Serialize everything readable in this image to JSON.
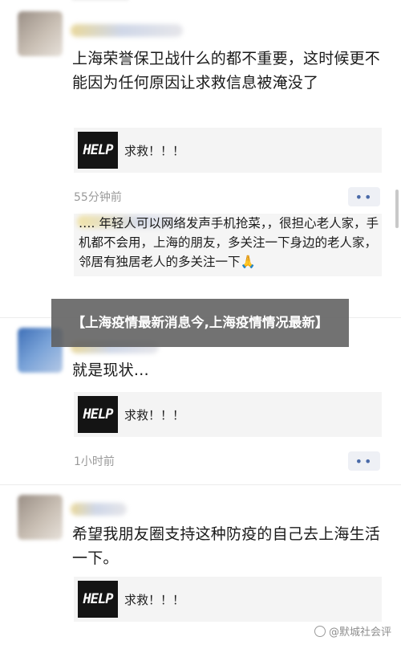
{
  "posts": [
    {
      "text": "上海荣誉保卫战什么的都不重要，这时候更不能因为任何原因让求救信息被淹没了",
      "link_card": {
        "logo": "HELP",
        "title": "求救！！！"
      },
      "time": "55分钟前",
      "more": "••",
      "comment": "…. 年轻人可以网络发声手机抢菜，，很担心老人家，手机都不会用，上海的朋友，多关注一下身边的老人家，邻居有独居老人的多关注一下🙏"
    },
    {
      "text": "就是现状…",
      "link_card": {
        "logo": "HELP",
        "title": "求救！！！"
      },
      "time": "1小时前",
      "more": "••"
    },
    {
      "text": "希望我朋友圈支持这种防疫的自己去上海生活一下。",
      "link_card": {
        "logo": "HELP",
        "title": "求救！！！"
      }
    }
  ],
  "banner": "【上海疫情最新消息今,上海疫情情况最新】",
  "watermark": "@默城社会评"
}
